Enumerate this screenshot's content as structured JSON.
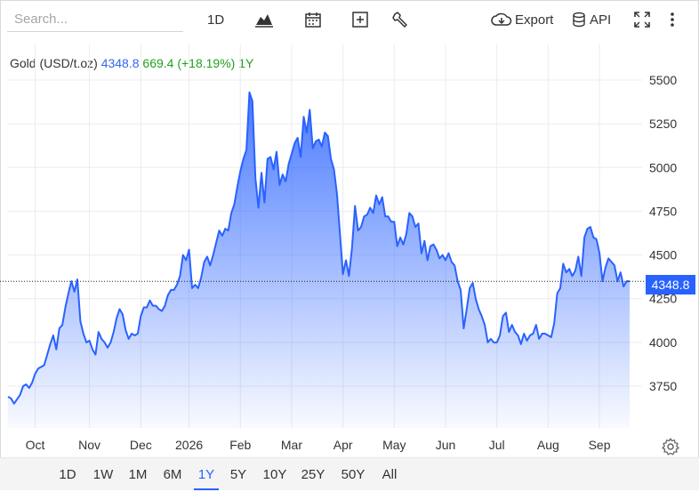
{
  "toolbar": {
    "search_placeholder": "Search...",
    "interval": "1D",
    "export_label": "Export",
    "api_label": "API"
  },
  "legend": {
    "name": "Gold (USD/t.oz)",
    "price": "4348.8",
    "change": "669.4 (+18.19%)",
    "period": "1Y"
  },
  "price_badge": "4348.8",
  "range_buttons": [
    "1D",
    "1W",
    "1M",
    "6M",
    "1Y",
    "5Y",
    "10Y",
    "25Y",
    "50Y",
    "All"
  ],
  "active_range": "1Y",
  "colors": {
    "line": "#2962ff",
    "badge": "#2962ff",
    "change": "#22a022"
  },
  "chart_data": {
    "type": "area",
    "series": [
      {
        "points": [
          [
            0,
            3690
          ],
          [
            1,
            3680
          ],
          [
            2,
            3650
          ],
          [
            4,
            3700
          ],
          [
            5,
            3750
          ],
          [
            6,
            3760
          ],
          [
            7,
            3740
          ],
          [
            8,
            3770
          ],
          [
            9,
            3820
          ],
          [
            10,
            3850
          ],
          [
            11,
            3860
          ],
          [
            12,
            3870
          ],
          [
            13,
            3930
          ],
          [
            14,
            3990
          ],
          [
            15,
            4040
          ],
          [
            16,
            3960
          ],
          [
            17,
            4080
          ],
          [
            18,
            4100
          ],
          [
            19,
            4200
          ],
          [
            20,
            4280
          ],
          [
            21,
            4350
          ],
          [
            22,
            4290
          ],
          [
            23,
            4360
          ],
          [
            24,
            4120
          ],
          [
            25,
            4050
          ],
          [
            26,
            4000
          ],
          [
            27,
            4010
          ],
          [
            28,
            3960
          ],
          [
            29,
            3930
          ],
          [
            30,
            4060
          ],
          [
            31,
            4020
          ],
          [
            32,
            4000
          ],
          [
            33,
            3970
          ],
          [
            34,
            4000
          ],
          [
            35,
            4060
          ],
          [
            36,
            4140
          ],
          [
            37,
            4190
          ],
          [
            38,
            4160
          ],
          [
            39,
            4070
          ],
          [
            40,
            4020
          ],
          [
            41,
            4050
          ],
          [
            42,
            4040
          ],
          [
            43,
            4050
          ],
          [
            44,
            4150
          ],
          [
            45,
            4200
          ],
          [
            46,
            4200
          ],
          [
            47,
            4240
          ],
          [
            48,
            4210
          ],
          [
            49,
            4210
          ],
          [
            50,
            4190
          ],
          [
            51,
            4180
          ],
          [
            52,
            4210
          ],
          [
            53,
            4270
          ],
          [
            54,
            4300
          ],
          [
            55,
            4300
          ],
          [
            56,
            4330
          ],
          [
            57,
            4380
          ],
          [
            58,
            4500
          ],
          [
            59,
            4470
          ],
          [
            60,
            4530
          ],
          [
            61,
            4310
          ],
          [
            62,
            4330
          ],
          [
            63,
            4310
          ],
          [
            64,
            4370
          ],
          [
            65,
            4460
          ],
          [
            66,
            4490
          ],
          [
            67,
            4440
          ],
          [
            68,
            4500
          ],
          [
            69,
            4570
          ],
          [
            70,
            4640
          ],
          [
            71,
            4610
          ],
          [
            72,
            4650
          ],
          [
            73,
            4640
          ],
          [
            74,
            4740
          ],
          [
            75,
            4790
          ],
          [
            76,
            4890
          ],
          [
            77,
            4980
          ],
          [
            78,
            5050
          ],
          [
            79,
            5100
          ],
          [
            80,
            5430
          ],
          [
            81,
            5380
          ],
          [
            82,
            4940
          ],
          [
            83,
            4770
          ],
          [
            84,
            4970
          ],
          [
            85,
            4800
          ],
          [
            86,
            5050
          ],
          [
            87,
            5060
          ],
          [
            88,
            4990
          ],
          [
            89,
            5090
          ],
          [
            90,
            4900
          ],
          [
            91,
            4960
          ],
          [
            92,
            4920
          ],
          [
            93,
            5020
          ],
          [
            94,
            5080
          ],
          [
            95,
            5140
          ],
          [
            96,
            5170
          ],
          [
            97,
            5060
          ],
          [
            98,
            5290
          ],
          [
            99,
            5200
          ],
          [
            100,
            5330
          ],
          [
            101,
            5110
          ],
          [
            102,
            5150
          ],
          [
            103,
            5160
          ],
          [
            104,
            5120
          ],
          [
            105,
            5200
          ],
          [
            106,
            5180
          ],
          [
            107,
            5050
          ],
          [
            108,
            4990
          ],
          [
            109,
            4850
          ],
          [
            110,
            4620
          ],
          [
            111,
            4390
          ],
          [
            112,
            4470
          ],
          [
            113,
            4380
          ],
          [
            114,
            4540
          ],
          [
            115,
            4780
          ],
          [
            116,
            4640
          ],
          [
            117,
            4660
          ],
          [
            118,
            4720
          ],
          [
            119,
            4730
          ],
          [
            120,
            4770
          ],
          [
            121,
            4740
          ],
          [
            122,
            4840
          ],
          [
            123,
            4790
          ],
          [
            124,
            4830
          ],
          [
            125,
            4720
          ],
          [
            126,
            4720
          ],
          [
            127,
            4690
          ],
          [
            128,
            4690
          ],
          [
            129,
            4550
          ],
          [
            130,
            4600
          ],
          [
            131,
            4560
          ],
          [
            132,
            4620
          ],
          [
            133,
            4740
          ],
          [
            134,
            4720
          ],
          [
            135,
            4660
          ],
          [
            136,
            4680
          ],
          [
            137,
            4510
          ],
          [
            138,
            4580
          ],
          [
            139,
            4470
          ],
          [
            140,
            4550
          ],
          [
            141,
            4560
          ],
          [
            142,
            4530
          ],
          [
            143,
            4480
          ],
          [
            144,
            4500
          ],
          [
            145,
            4470
          ],
          [
            146,
            4510
          ],
          [
            147,
            4460
          ],
          [
            148,
            4440
          ],
          [
            149,
            4350
          ],
          [
            150,
            4300
          ],
          [
            151,
            4080
          ],
          [
            152,
            4190
          ],
          [
            153,
            4310
          ],
          [
            154,
            4340
          ],
          [
            155,
            4250
          ],
          [
            156,
            4190
          ],
          [
            157,
            4150
          ],
          [
            158,
            4100
          ],
          [
            159,
            4000
          ],
          [
            160,
            4020
          ],
          [
            161,
            4000
          ],
          [
            162,
            4000
          ],
          [
            163,
            4040
          ],
          [
            164,
            4150
          ],
          [
            165,
            4170
          ],
          [
            166,
            4060
          ],
          [
            167,
            4100
          ],
          [
            168,
            4060
          ],
          [
            169,
            4040
          ],
          [
            170,
            3990
          ],
          [
            171,
            4050
          ],
          [
            172,
            4010
          ],
          [
            173,
            4040
          ],
          [
            174,
            4050
          ],
          [
            175,
            4100
          ],
          [
            176,
            4020
          ],
          [
            177,
            4050
          ],
          [
            178,
            4050
          ],
          [
            179,
            4040
          ],
          [
            180,
            4030
          ],
          [
            181,
            4110
          ],
          [
            182,
            4280
          ],
          [
            183,
            4310
          ],
          [
            184,
            4450
          ],
          [
            185,
            4400
          ],
          [
            186,
            4420
          ],
          [
            187,
            4380
          ],
          [
            188,
            4410
          ],
          [
            189,
            4490
          ],
          [
            190,
            4380
          ],
          [
            191,
            4600
          ],
          [
            192,
            4650
          ],
          [
            193,
            4660
          ],
          [
            194,
            4600
          ],
          [
            195,
            4590
          ],
          [
            196,
            4510
          ],
          [
            197,
            4350
          ],
          [
            198,
            4430
          ],
          [
            199,
            4480
          ],
          [
            200,
            4460
          ],
          [
            201,
            4440
          ],
          [
            202,
            4350
          ],
          [
            203,
            4400
          ],
          [
            204,
            4320
          ],
          [
            205,
            4350
          ],
          [
            206,
            4350
          ]
        ]
      }
    ],
    "x_tick_labels": [
      "Oct",
      "Nov",
      "Dec",
      "2026",
      "Feb",
      "Mar",
      "Apr",
      "May",
      "Jun",
      "Jul",
      "Aug",
      "Sep"
    ],
    "x_tick_index": [
      9,
      27,
      44,
      60,
      77,
      94,
      111,
      128,
      145,
      162,
      179,
      196
    ],
    "y_ticks": [
      3750,
      4000,
      4250,
      4500,
      4750,
      5000,
      5250,
      5500
    ],
    "ylim": [
      3560,
      5590
    ],
    "last_value": 4348.8,
    "grid": true
  }
}
